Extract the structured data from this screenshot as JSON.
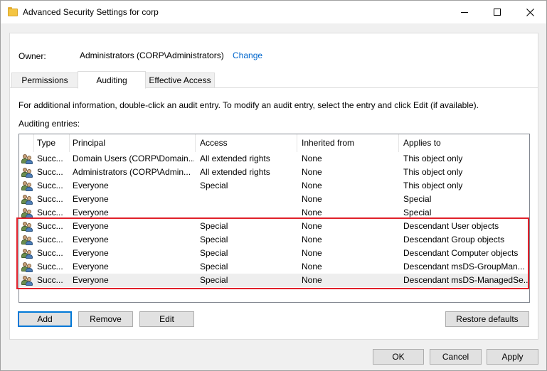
{
  "window": {
    "title": "Advanced Security Settings for corp",
    "icon": "folder-icon"
  },
  "owner": {
    "label": "Owner:",
    "value": "Administrators (CORP\\Administrators)",
    "change_link": "Change"
  },
  "tabs": [
    {
      "label": "Permissions",
      "active": false
    },
    {
      "label": "Auditing",
      "active": true
    },
    {
      "label": "Effective Access",
      "active": false
    }
  ],
  "info_text": "For additional information, double-click an audit entry. To modify an audit entry, select the entry and click Edit (if available).",
  "entries_label": "Auditing entries:",
  "columns": {
    "type": "Type",
    "principal": "Principal",
    "access": "Access",
    "inherited": "Inherited from",
    "applies": "Applies to"
  },
  "entries": [
    {
      "type": "Succ...",
      "principal": "Domain Users (CORP\\Domain...",
      "access": "All extended rights",
      "inherited": "None",
      "applies": "This object only"
    },
    {
      "type": "Succ...",
      "principal": "Administrators (CORP\\Admin...",
      "access": "All extended rights",
      "inherited": "None",
      "applies": "This object only"
    },
    {
      "type": "Succ...",
      "principal": "Everyone",
      "access": "Special",
      "inherited": "None",
      "applies": "This object only"
    },
    {
      "type": "Succ...",
      "principal": "Everyone",
      "access": "",
      "inherited": "None",
      "applies": "Special"
    },
    {
      "type": "Succ...",
      "principal": "Everyone",
      "access": "",
      "inherited": "None",
      "applies": "Special"
    },
    {
      "type": "Succ...",
      "principal": "Everyone",
      "access": "Special",
      "inherited": "None",
      "applies": "Descendant User objects"
    },
    {
      "type": "Succ...",
      "principal": "Everyone",
      "access": "Special",
      "inherited": "None",
      "applies": "Descendant Group objects"
    },
    {
      "type": "Succ...",
      "principal": "Everyone",
      "access": "Special",
      "inherited": "None",
      "applies": "Descendant Computer objects"
    },
    {
      "type": "Succ...",
      "principal": "Everyone",
      "access": "Special",
      "inherited": "None",
      "applies": "Descendant msDS-GroupMan..."
    },
    {
      "type": "Succ...",
      "principal": "Everyone",
      "access": "Special",
      "inherited": "None",
      "applies": "Descendant msDS-ManagedSe..."
    }
  ],
  "selected_entry": 9,
  "highlight_color": "#e0202a",
  "buttons": {
    "add": "Add",
    "remove": "Remove",
    "edit": "Edit",
    "restore": "Restore defaults",
    "ok": "OK",
    "cancel": "Cancel",
    "apply": "Apply"
  }
}
